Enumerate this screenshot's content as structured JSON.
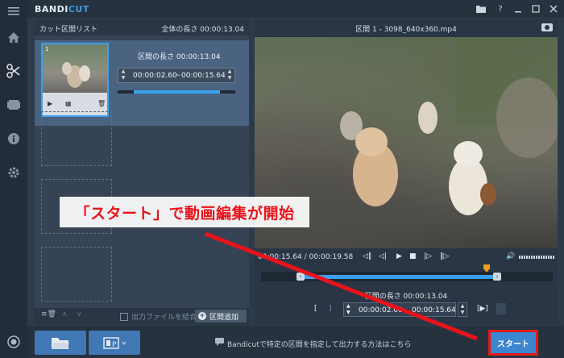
{
  "app": {
    "logo_a": "BANDI",
    "logo_b": "CUT"
  },
  "window_controls": [
    "folder-icon",
    "help-icon",
    "minimize-icon",
    "maximize-icon",
    "close-icon"
  ],
  "sidebar": {
    "items": [
      "home-icon",
      "cut-icon",
      "film-icon",
      "info-icon",
      "settings-icon",
      "record-icon"
    ]
  },
  "left_panel": {
    "title": "カット区間リスト",
    "total_length": "全体の長さ 00:00:13.04",
    "clip": {
      "number": "1",
      "segment_length": "区間の長さ 00:00:13.04",
      "start_time": "00:00:02.60",
      "separator": "~",
      "end_time": "00:00:15.64",
      "progress": 0.73
    },
    "footer": {
      "merge_label": "出力ファイルを結合",
      "add_segment": "区間追加"
    }
  },
  "right_panel": {
    "file_title": "区間 1 - 3098_640x360.mp4",
    "playback_time": "00:00:15.64 / 00:00:19.58",
    "segment_length": "区間の長さ 00:00:13.04",
    "start_time": "00:00:02.60",
    "end_time": "00:00:15.64"
  },
  "bottom": {
    "hint": "Bandicutで特定の区間を指定して出力する方法はこちら",
    "start_button": "スタート"
  },
  "annotation": {
    "callout_text": "「スタート」で動画編集が開始",
    "color": "#e8131b"
  }
}
